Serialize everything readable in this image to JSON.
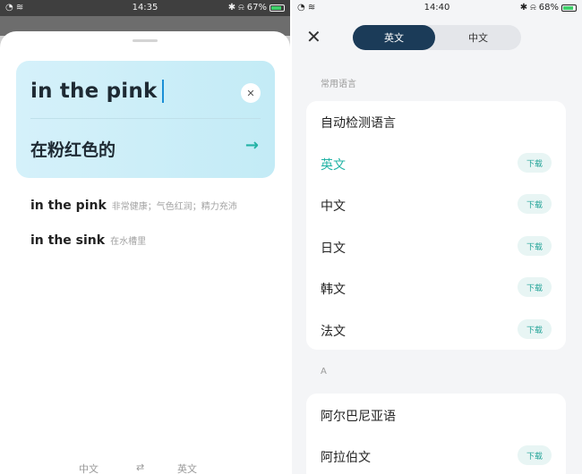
{
  "left_screen": {
    "status_bar": {
      "time": "14:35",
      "battery": "67%"
    },
    "input": {
      "query": "in the pink",
      "clear_icon": "close-icon"
    },
    "translation": {
      "text": "在粉红色的",
      "arrow_icon": "arrow-right-icon"
    },
    "suggestions": [
      {
        "phrase": "in the pink",
        "meaning": "非常健康；气色红润；精力充沛"
      },
      {
        "phrase": "in the sink",
        "meaning": "在水槽里"
      }
    ],
    "bottom_bar": {
      "source_lang": "中文",
      "swap_icon": "swap-icon",
      "target_lang": "英文"
    }
  },
  "right_screen": {
    "status_bar": {
      "time": "14:40",
      "battery": "68%"
    },
    "close_icon": "close-icon",
    "tabs": [
      {
        "label": "英文",
        "active": true
      },
      {
        "label": "中文",
        "active": false
      }
    ],
    "common_section": {
      "header": "常用语言",
      "items": [
        {
          "name": "自动检测语言",
          "download": ""
        },
        {
          "name": "英文",
          "download": "下载",
          "selected": true
        },
        {
          "name": "中文",
          "download": "下载"
        },
        {
          "name": "日文",
          "download": "下载"
        },
        {
          "name": "韩文",
          "download": "下载"
        },
        {
          "name": "法文",
          "download": "下载"
        }
      ]
    },
    "a_section": {
      "header": "A",
      "items": [
        {
          "name": "阿尔巴尼亚语",
          "download": ""
        },
        {
          "name": "阿拉伯文",
          "download": "下载"
        }
      ]
    }
  },
  "colors": {
    "accent": "#22b3a5",
    "tab_active": "#1b3b58",
    "input_card": "#c8edf7"
  }
}
